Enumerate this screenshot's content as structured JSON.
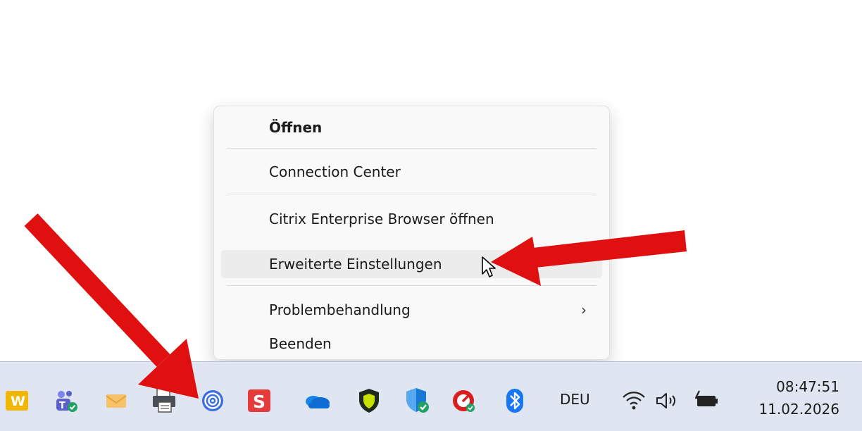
{
  "context_menu": {
    "items": [
      {
        "label": "Öffnen"
      },
      {
        "label": "Connection Center"
      },
      {
        "label": "Citrix Enterprise Browser öffnen"
      },
      {
        "label": "Erweiterte Einstellungen"
      },
      {
        "label": "Problembehandlung",
        "submenu_indicator": "›"
      },
      {
        "label": "Beenden"
      }
    ]
  },
  "taskbar": {
    "tray_icons": [
      "w-app-icon",
      "teams-icon",
      "mail-icon",
      "printer-fax-icon",
      "citrix-workspace-icon",
      "s-app-icon",
      "onedrive-icon",
      "shield-security-icon",
      "defender-icon",
      "speedometer-app-icon",
      "bluetooth-icon"
    ],
    "language": "DEU",
    "time": "08:47:51",
    "date": "11.02.2026"
  },
  "colors": {
    "arrow": "#e01010",
    "menu_bg": "#f9f9f9",
    "taskbar_bg": "#dfe6f1"
  }
}
